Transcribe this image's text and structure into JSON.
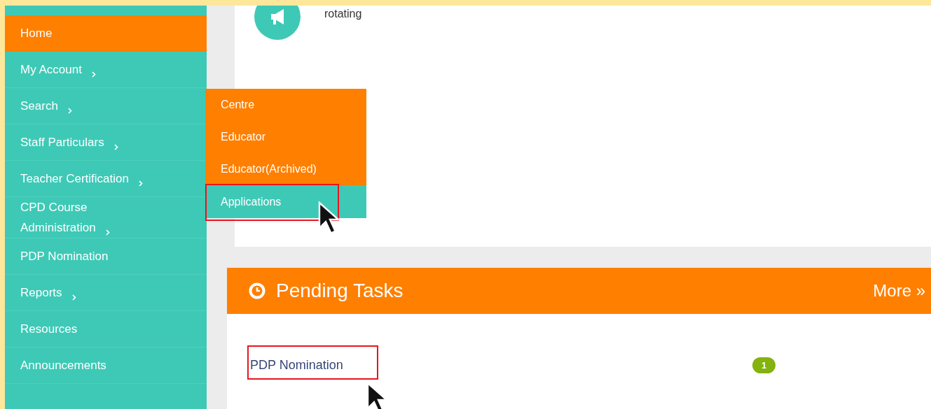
{
  "sidebar": {
    "items": [
      {
        "label": "Home",
        "selected": true,
        "has_submenu": false
      },
      {
        "label": "My Account",
        "selected": false,
        "has_submenu": true
      },
      {
        "label": "Search",
        "selected": false,
        "has_submenu": true
      },
      {
        "label": "Staff Particulars",
        "selected": false,
        "has_submenu": true
      },
      {
        "label": "Teacher Certification",
        "selected": false,
        "has_submenu": true
      },
      {
        "label": "CPD Course Administration",
        "selected": false,
        "has_submenu": true
      },
      {
        "label": "PDP Nomination",
        "selected": false,
        "has_submenu": false
      },
      {
        "label": "Reports",
        "selected": false,
        "has_submenu": true
      },
      {
        "label": "Resources",
        "selected": false,
        "has_submenu": false
      },
      {
        "label": "Announcements",
        "selected": false,
        "has_submenu": false
      }
    ]
  },
  "submenu": {
    "items": [
      {
        "label": "Centre",
        "selected": false,
        "highlighted": false
      },
      {
        "label": "Educator",
        "selected": false,
        "highlighted": false
      },
      {
        "label": "Educator(Archived)",
        "selected": false,
        "highlighted": false
      },
      {
        "label": "Applications",
        "selected": true,
        "highlighted": true
      }
    ]
  },
  "announcement": {
    "text": "rotating"
  },
  "pending_tasks": {
    "title": "Pending Tasks",
    "more": "More »",
    "tasks": [
      {
        "label": "PDP Nomination",
        "count": "1",
        "highlighted": true
      }
    ]
  }
}
